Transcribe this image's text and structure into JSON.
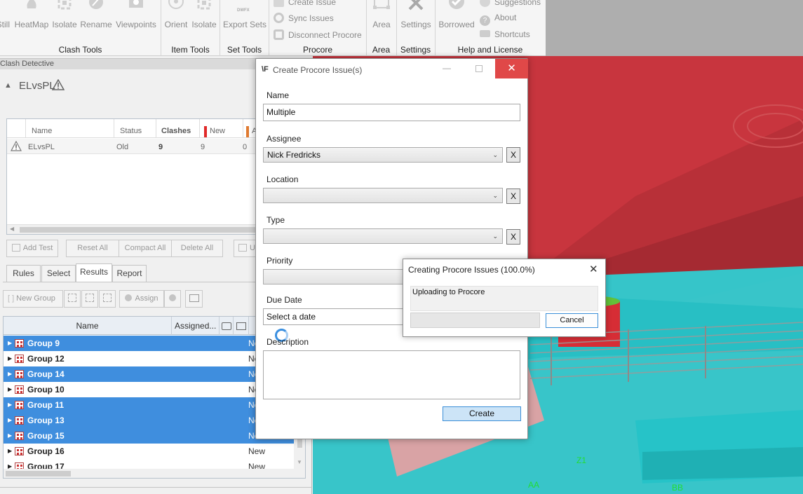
{
  "ribbon": {
    "clash_tools": {
      "group_label": "Clash Tools",
      "buttons": [
        "Still",
        "HeatMap",
        "Isolate",
        "Rename",
        "Viewpoints"
      ]
    },
    "item_tools": {
      "group_label": "Item Tools",
      "buttons": [
        "Orient",
        "Isolate"
      ]
    },
    "set_tools": {
      "group_label": "Set Tools",
      "buttons": [
        "Export Sets"
      ],
      "dwfx_badge": "DWFX"
    },
    "procore": {
      "group_label": "Procore",
      "items": [
        "Create Issue",
        "Sync Issues",
        "Disconnect Procore"
      ]
    },
    "area": {
      "group_label": "Area",
      "buttons": [
        "Area"
      ]
    },
    "settings": {
      "group_label": "Settings",
      "buttons": [
        "Settings"
      ]
    },
    "help": {
      "group_label": "Help and License",
      "buttons": [
        "Borrowed"
      ],
      "items": [
        "Suggestions",
        "About",
        "Shortcuts"
      ]
    }
  },
  "clash_panel": {
    "title": "Clash Detective",
    "test_name": "ELvsPL",
    "tests_table": {
      "headers": [
        "Name",
        "Status",
        "Clashes",
        "New",
        "A"
      ],
      "rows": [
        {
          "name": "ELvsPL",
          "status": "Old",
          "clashes": "9",
          "new": "9",
          "active": "0"
        }
      ]
    },
    "buttons": {
      "add_test": "Add Test",
      "reset_all": "Reset All",
      "compact_all": "Compact All",
      "delete_all": "Delete All",
      "update": "U"
    },
    "tabs": [
      "Rules",
      "Select",
      "Results",
      "Report"
    ],
    "results_toolbar": {
      "new_group": "New Group",
      "assign": "Assign"
    },
    "results_table": {
      "headers": {
        "name": "Name",
        "assigned": "Assigned..."
      },
      "rows": [
        {
          "name": "Group 9",
          "status": "New",
          "selected": true
        },
        {
          "name": "Group 12",
          "status": "New",
          "selected": false
        },
        {
          "name": "Group 14",
          "status": "New",
          "selected": true
        },
        {
          "name": "Group 10",
          "status": "New",
          "selected": false
        },
        {
          "name": "Group 11",
          "status": "New",
          "selected": true
        },
        {
          "name": "Group 13",
          "status": "New",
          "selected": true
        },
        {
          "name": "Group 15",
          "status": "New",
          "selected": true
        },
        {
          "name": "Group 16",
          "status": "New",
          "selected": false
        },
        {
          "name": "Group 17",
          "status": "New",
          "selected": false
        }
      ]
    }
  },
  "create_dialog": {
    "title": "Create Procore Issue(s)",
    "logo_glyph": "\\F",
    "close_glyph": "✕",
    "fields": {
      "name_label": "Name",
      "name_value": "Multiple",
      "assignee_label": "Assignee",
      "assignee_value": "Nick Fredricks",
      "location_label": "Location",
      "location_value": "",
      "type_label": "Type",
      "type_value": "",
      "priority_label": "Priority",
      "due_date_label": "Due Date",
      "due_date_placeholder": "Select a date",
      "description_label": "Description"
    },
    "clear_glyph": "X",
    "create_label": "Create"
  },
  "progress_dialog": {
    "title": "Creating Procore Issues (100.0%)",
    "message": "Uploading to Procore",
    "progress": 1.0,
    "cancel_label": "Cancel",
    "close_glyph": "✕"
  },
  "viewport_labels": [
    "Z1",
    "AA",
    "BB"
  ],
  "colors": {
    "selection": "#3f8ede",
    "close_red": "#e04848",
    "model_red": "#c0323b",
    "model_cyan": "#2ad6d9",
    "grid_green": "#22dd33"
  }
}
